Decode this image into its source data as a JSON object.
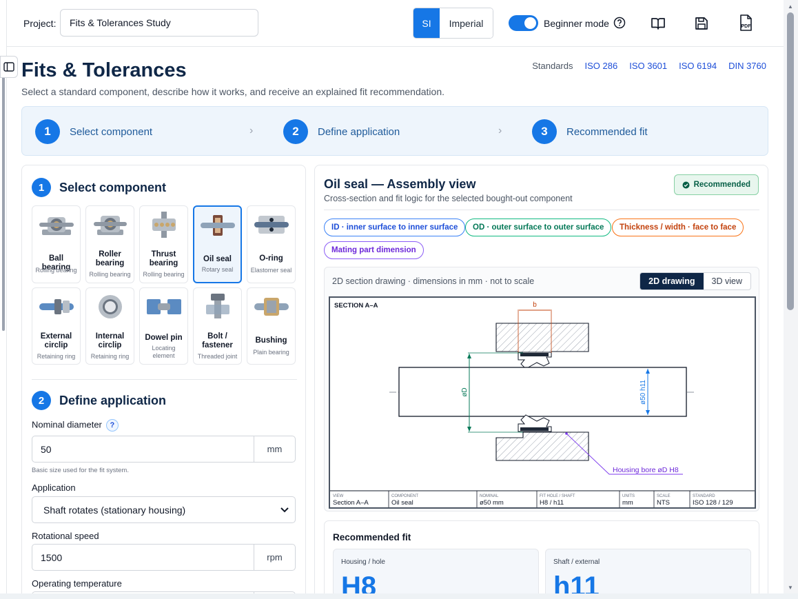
{
  "header": {
    "project_label": "Project:",
    "project_value": "Fits & Tolerances Study",
    "unit_si": "SI",
    "unit_imperial": "Imperial",
    "beginner_label": "Beginner mode",
    "beginner_on": true,
    "icons": [
      "help-icon",
      "book-icon",
      "save-icon",
      "pdf-icon"
    ],
    "pdf_text": "PDF"
  },
  "page": {
    "title": "Fits & Tolerances",
    "subtitle": "Select a standard component, describe how it works, and receive an explained fit recommendation.",
    "standards_label": "Standards",
    "standards": [
      "ISO 286",
      "ISO 3601",
      "ISO 6194",
      "DIN 3760"
    ]
  },
  "stepper": [
    {
      "num": "1",
      "label": "Select component"
    },
    {
      "num": "2",
      "label": "Define application"
    },
    {
      "num": "3",
      "label": "Recommended fit"
    }
  ],
  "select_section": {
    "num": "1",
    "title": "Select component",
    "components": [
      {
        "name": "Ball bearing",
        "sub": "Rolling bearing",
        "selected": false
      },
      {
        "name": "Roller bearing",
        "sub": "Rolling bearing",
        "selected": false
      },
      {
        "name": "Thrust bearing",
        "sub": "Rolling bearing",
        "selected": false
      },
      {
        "name": "Oil seal",
        "sub": "Rotary seal",
        "selected": true
      },
      {
        "name": "O-ring",
        "sub": "Elastomer seal",
        "selected": false
      },
      {
        "name": "External circlip",
        "sub": "Retaining ring",
        "selected": false
      },
      {
        "name": "Internal circlip",
        "sub": "Retaining ring",
        "selected": false
      },
      {
        "name": "Dowel pin",
        "sub": "Locating element",
        "selected": false
      },
      {
        "name": "Bolt / fastener",
        "sub": "Threaded joint",
        "selected": false
      },
      {
        "name": "Bushing",
        "sub": "Plain bearing",
        "selected": false
      }
    ]
  },
  "define_section": {
    "num": "2",
    "title": "Define application",
    "nominal_label": "Nominal diameter",
    "help_mark": "?",
    "nominal_value": "50",
    "nominal_unit": "mm",
    "nominal_hint": "Basic size used for the fit system.",
    "application_label": "Application",
    "application_value": "Shaft rotates (stationary housing)",
    "speed_label": "Rotational speed",
    "speed_value": "1500",
    "speed_unit": "rpm",
    "temp_label": "Operating temperature"
  },
  "detail": {
    "title": "Oil seal — Assembly view",
    "subtitle": "Cross-section and fit logic for the selected bought-out component",
    "badge": "Recommended",
    "tags": [
      {
        "label": "ID · inner surface to inner surface",
        "color": "blue"
      },
      {
        "label": "OD · outer surface to outer surface",
        "color": "green"
      },
      {
        "label": "Thickness / width · face to face",
        "color": "orange"
      },
      {
        "label": "Mating part dimension",
        "color": "purple"
      }
    ],
    "drawing_caption": "2D section drawing · dimensions in mm · not to scale",
    "view_2d": "2D drawing",
    "view_3d": "3D view",
    "drawing": {
      "section_label": "SECTION A–A",
      "dim_b": "b",
      "dim_od": "øD",
      "dim_shaft": "ø50 h11",
      "callout": "Housing bore øD H8",
      "title_block": [
        {
          "head": "VIEW",
          "value": "Section A–A"
        },
        {
          "head": "COMPONENT",
          "value": "Oil seal"
        },
        {
          "head": "NOMINAL",
          "value": "ø50 mm"
        },
        {
          "head": "FIT HOLE / SHAFT",
          "value": "H8 / h11"
        },
        {
          "head": "UNITS",
          "value": "mm"
        },
        {
          "head": "SCALE",
          "value": "NTS"
        },
        {
          "head": "STANDARD",
          "value": "ISO 128 / 129"
        }
      ]
    },
    "fit": {
      "title": "Recommended fit",
      "hole_label": "Housing / hole",
      "hole_value": "H8",
      "shaft_label": "Shaft / external",
      "shaft_value": "h11"
    }
  }
}
